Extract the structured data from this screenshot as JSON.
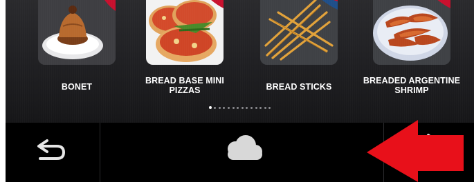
{
  "products": [
    {
      "name": "BONET",
      "icon": "bonet-dessert-image"
    },
    {
      "name": "BREAD BASE MINI PIZZAS",
      "icon": "mini-pizzas-image"
    },
    {
      "name": "BREAD STICKS",
      "icon": "bread-sticks-image"
    },
    {
      "name": "BREADED ARGENTINE SHRIMP",
      "icon": "breaded-shrimp-image"
    }
  ],
  "pager": {
    "total": 14,
    "active": 0
  },
  "bottom_bar": {
    "back": "back-icon",
    "cloud": "cloud-icon"
  },
  "colors": {
    "background": "#000000",
    "tile_background": "#3c3c40",
    "badge": "#c8102e",
    "arrow": "#e8101a"
  }
}
